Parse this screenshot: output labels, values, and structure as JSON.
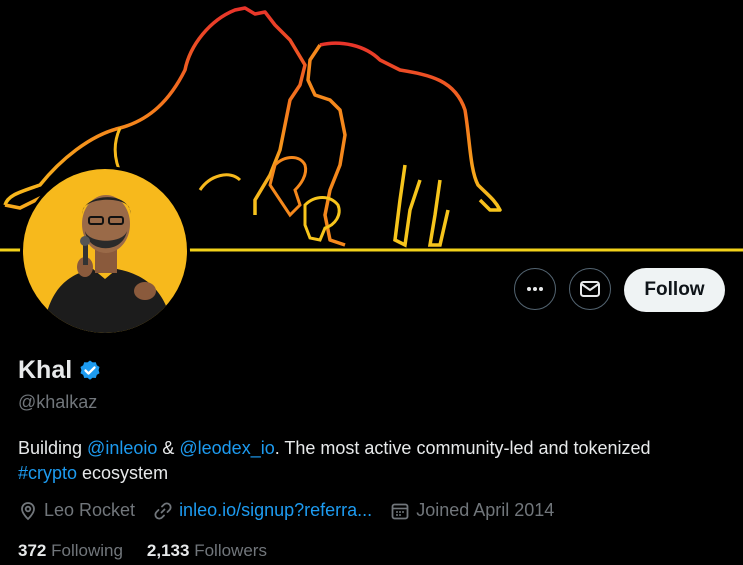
{
  "profile": {
    "name": "Khal",
    "handle": "@khalkaz",
    "verified": true,
    "bio": {
      "part1": "Building ",
      "mention1": "@inleoio",
      "part2": " & ",
      "mention2": "@leodex_io",
      "part3": ". The most active community-led and tokenized",
      "hashtag": "#crypto",
      "part4": " ecosystem"
    },
    "location": "Leo Rocket",
    "website": "inleo.io/signup?referra...",
    "joined": "Joined April 2014",
    "following_count": "372",
    "following_label": "Following",
    "followers_count": "2,133",
    "followers_label": "Followers"
  },
  "actions": {
    "more_icon": "more-icon",
    "message_icon": "envelope-icon",
    "follow_label": "Follow"
  },
  "colors": {
    "background": "#000000",
    "accent": "#1d9bf0",
    "muted": "#71767b",
    "avatar_bg": "#f7b91c",
    "verified": "#1d9bf0"
  }
}
